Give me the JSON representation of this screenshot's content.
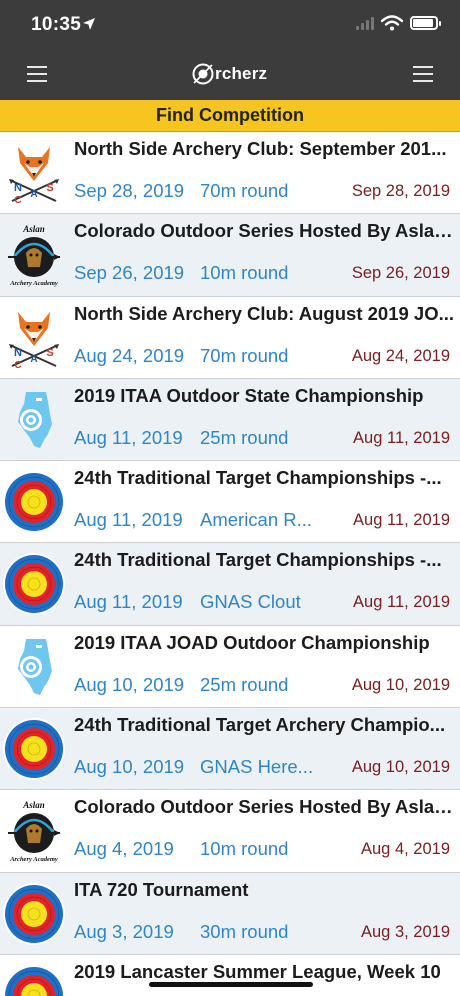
{
  "status": {
    "time": "10:35",
    "battery_level": 0.92
  },
  "nav": {
    "logo_text": "rcherz"
  },
  "title_bar": {
    "title": "Find Competition"
  },
  "competitions": [
    {
      "title": "North Side Archery Club: September 201...",
      "date": "Sep 28, 2019",
      "round": "70m round",
      "date_right": "Sep 28, 2019",
      "thumb": "fox-icon"
    },
    {
      "title": "Colorado Outdoor Series Hosted By Aslan...",
      "date": "Sep 26, 2019",
      "round": "10m round",
      "date_right": "Sep 26, 2019",
      "thumb": "aslan-icon"
    },
    {
      "title": "North Side Archery Club: August 2019 JO...",
      "date": "Aug 24, 2019",
      "round": "70m round",
      "date_right": "Aug 24, 2019",
      "thumb": "fox-icon"
    },
    {
      "title": "2019 ITAA Outdoor State Championship",
      "date": "Aug 11, 2019",
      "round": "25m round",
      "date_right": "Aug 11, 2019",
      "thumb": "illinois-icon"
    },
    {
      "title": "24th Traditional Target Championships -...",
      "date": "Aug 11, 2019",
      "round": "American R...",
      "date_right": "Aug 11, 2019",
      "thumb": "target-icon"
    },
    {
      "title": "24th Traditional Target Championships -...",
      "date": "Aug 11, 2019",
      "round": "GNAS Clout",
      "date_right": "Aug 11, 2019",
      "thumb": "target-icon"
    },
    {
      "title": "2019 ITAA JOAD Outdoor Championship",
      "date": "Aug 10, 2019",
      "round": "25m round",
      "date_right": "Aug 10, 2019",
      "thumb": "illinois-icon"
    },
    {
      "title": "24th Traditional Target Archery Champio...",
      "date": "Aug 10, 2019",
      "round": "GNAS Here...",
      "date_right": "Aug 10, 2019",
      "thumb": "target-icon"
    },
    {
      "title": "Colorado Outdoor Series Hosted By Aslan...",
      "date": "Aug 4, 2019",
      "round": "10m round",
      "date_right": "Aug 4, 2019",
      "thumb": "aslan-icon"
    },
    {
      "title": "ITA 720 Tournament",
      "date": "Aug 3, 2019",
      "round": "30m round",
      "date_right": "Aug 3, 2019",
      "thumb": "target-icon"
    },
    {
      "title": "2019 Lancaster Summer League, Week 10",
      "date": "",
      "round": "",
      "date_right": "",
      "thumb": "target-icon"
    }
  ],
  "logo_labels": {
    "fox_top": "N",
    "fox_mid_left": "C",
    "fox_mid_right": "S",
    "fox_center": "A",
    "aslan_top": "Aslan",
    "aslan_bottom": "Archery Academy"
  },
  "colors": {
    "nav_bg": "#3c3c3c",
    "title_bar_bg": "#f7c51f",
    "link_blue": "#2f86c7",
    "date_dark_red": "#7a2020",
    "alt_row_bg": "#ecf1f6"
  }
}
